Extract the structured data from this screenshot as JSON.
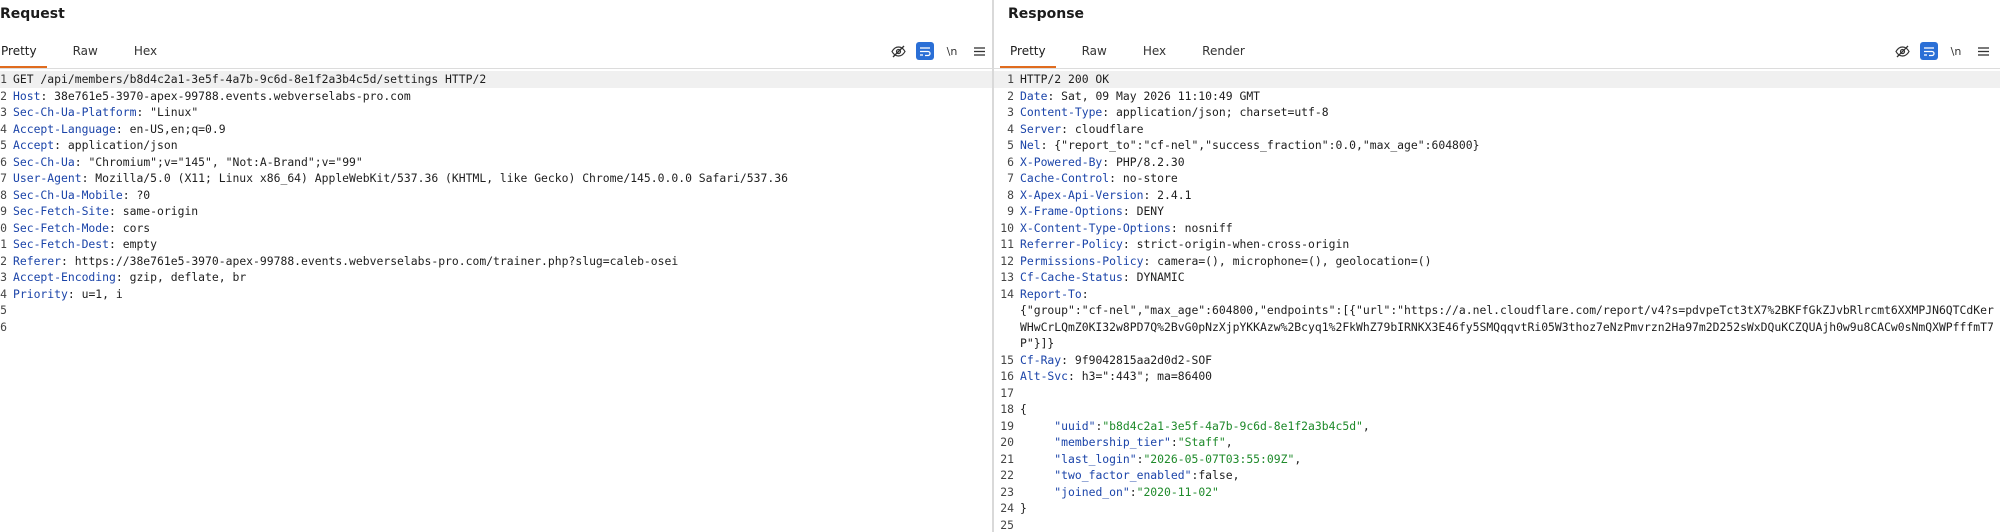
{
  "request": {
    "title": "Request",
    "tabs": [
      {
        "label": "Pretty",
        "active": true
      },
      {
        "label": "Raw",
        "active": false
      },
      {
        "label": "Hex",
        "active": false
      }
    ],
    "newline_label": "\\n",
    "lines": [
      {
        "n": "1",
        "text": "GET /api/members/b8d4c2a1-3e5f-4a7b-9c6d-8e1f2a3b4c5d/settings HTTP/2"
      },
      {
        "n": "2",
        "key": "Host",
        "value": "38e761e5-3970-apex-99788.events.webverselabs-pro.com"
      },
      {
        "n": "3",
        "key": "Sec-Ch-Ua-Platform",
        "value": "\"Linux\""
      },
      {
        "n": "4",
        "key": "Accept-Language",
        "value": "en-US,en;q=0.9"
      },
      {
        "n": "5",
        "key": "Accept",
        "value": "application/json"
      },
      {
        "n": "6",
        "key": "Sec-Ch-Ua",
        "value": "\"Chromium\";v=\"145\", \"Not:A-Brand\";v=\"99\""
      },
      {
        "n": "7",
        "key": "User-Agent",
        "value": "Mozilla/5.0 (X11; Linux x86_64) AppleWebKit/537.36 (KHTML, like Gecko) Chrome/145.0.0.0 Safari/537.36"
      },
      {
        "n": "8",
        "key": "Sec-Ch-Ua-Mobile",
        "value": "?0"
      },
      {
        "n": "9",
        "key": "Sec-Fetch-Site",
        "value": "same-origin"
      },
      {
        "n": "0",
        "key": "Sec-Fetch-Mode",
        "value": "cors"
      },
      {
        "n": "1",
        "key": "Sec-Fetch-Dest",
        "value": "empty"
      },
      {
        "n": "2",
        "key": "Referer",
        "value": "https://38e761e5-3970-apex-99788.events.webverselabs-pro.com/trainer.php?slug=caleb-osei"
      },
      {
        "n": "3",
        "key": "Accept-Encoding",
        "value": "gzip, deflate, br"
      },
      {
        "n": "4",
        "key": "Priority",
        "value": "u=1, i"
      },
      {
        "n": "5",
        "text": ""
      },
      {
        "n": "6",
        "text": ""
      }
    ]
  },
  "response": {
    "title": "Response",
    "tabs": [
      {
        "label": "Pretty",
        "active": true
      },
      {
        "label": "Raw",
        "active": false
      },
      {
        "label": "Hex",
        "active": false
      },
      {
        "label": "Render",
        "active": false
      }
    ],
    "newline_label": "\\n",
    "lines": [
      {
        "n": "1",
        "text": "HTTP/2 200 OK"
      },
      {
        "n": "2",
        "key": "Date",
        "value": "Sat, 09 May 2026 11:10:49 GMT"
      },
      {
        "n": "3",
        "key": "Content-Type",
        "value": "application/json; charset=utf-8"
      },
      {
        "n": "4",
        "key": "Server",
        "value": "cloudflare"
      },
      {
        "n": "5",
        "key": "Nel",
        "value": "{\"report_to\":\"cf-nel\",\"success_fraction\":0.0,\"max_age\":604800}"
      },
      {
        "n": "6",
        "key": "X-Powered-By",
        "value": "PHP/8.2.30"
      },
      {
        "n": "7",
        "key": "Cache-Control",
        "value": "no-store"
      },
      {
        "n": "8",
        "key": "X-Apex-Api-Version",
        "value": "2.4.1"
      },
      {
        "n": "9",
        "key": "X-Frame-Options",
        "value": "DENY"
      },
      {
        "n": "10",
        "key": "X-Content-Type-Options",
        "value": "nosniff"
      },
      {
        "n": "11",
        "key": "Referrer-Policy",
        "value": "strict-origin-when-cross-origin"
      },
      {
        "n": "12",
        "key": "Permissions-Policy",
        "value": "camera=(), microphone=(), geolocation=()"
      },
      {
        "n": "13",
        "key": "Cf-Cache-Status",
        "value": "DYNAMIC"
      },
      {
        "n": "14",
        "key": "Report-To",
        "value": "",
        "wrapped": "{\"group\":\"cf-nel\",\"max_age\":604800,\"endpoints\":[{\"url\":\"https://a.nel.cloudflare.com/report/v4?s=pdvpeTct3tX7%2BKFfGkZJvbRlrcmt6XXMPJN6QTCdKerWHwCrLQmZ0KI32w8PD7Q%2BvG0pNzXjpYKKAzw%2Bcyq1%2FkWhZ79bIRNKX3E46fy5SMQqqvtRi05W3thoz7eNzPmvrzn2Ha97m2D252sWxDQuKCZQUAjh0w9u8CACw0sNmQXWPfffmT7P\"}]}"
      },
      {
        "n": "15",
        "key": "Cf-Ray",
        "value": "9f9042815aa2d0d2-SOF"
      },
      {
        "n": "16",
        "key": "Alt-Svc",
        "value": "h3=\":443\"; ma=86400"
      },
      {
        "n": "17",
        "text": ""
      },
      {
        "n": "18",
        "text": "{"
      },
      {
        "n": "19",
        "json_key": "\"uuid\"",
        "json_val": "\"b8d4c2a1-3e5f-4a7b-9c6d-8e1f2a3b4c5d\"",
        "json_type": "str",
        "comma": ","
      },
      {
        "n": "20",
        "json_key": "\"membership_tier\"",
        "json_val": "\"Staff\"",
        "json_type": "str",
        "comma": ","
      },
      {
        "n": "21",
        "json_key": "\"last_login\"",
        "json_val": "\"2026-05-07T03:55:09Z\"",
        "json_type": "str",
        "comma": ","
      },
      {
        "n": "22",
        "json_key": "\"two_factor_enabled\"",
        "json_val": "false",
        "json_type": "lit",
        "comma": ","
      },
      {
        "n": "23",
        "json_key": "\"joined_on\"",
        "json_val": "\"2020-11-02\"",
        "json_type": "str",
        "comma": ""
      },
      {
        "n": "24",
        "text": "}"
      },
      {
        "n": "25",
        "text": ""
      }
    ]
  }
}
